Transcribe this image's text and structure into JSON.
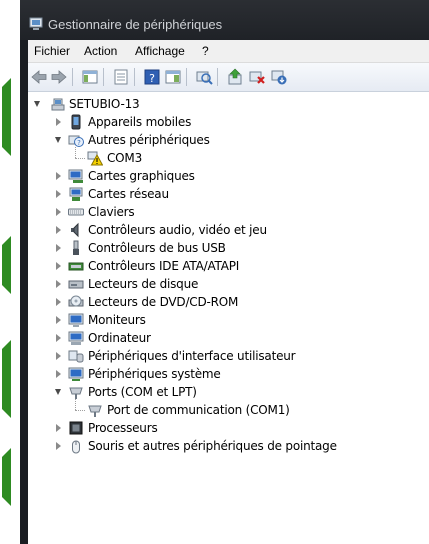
{
  "window": {
    "title": "Gestionnaire de périphériques"
  },
  "menu": {
    "file": "Fichier",
    "action": "Action",
    "view": "Affichage",
    "help": "?"
  },
  "tree": {
    "root": "SETUBIO-13",
    "items": [
      {
        "label": "Appareils mobiles",
        "icon": "mobile-device-icon",
        "expanded": false
      },
      {
        "label": "Autres périphériques",
        "icon": "unknown-device-icon",
        "expanded": true,
        "children": [
          {
            "label": "COM3",
            "icon": "warning-device-icon"
          }
        ]
      },
      {
        "label": "Cartes graphiques",
        "icon": "display-adapter-icon",
        "expanded": false
      },
      {
        "label": "Cartes réseau",
        "icon": "network-adapter-icon",
        "expanded": false
      },
      {
        "label": "Claviers",
        "icon": "keyboard-icon",
        "expanded": false
      },
      {
        "label": "Contrôleurs audio, vidéo et jeu",
        "icon": "speaker-icon",
        "expanded": false
      },
      {
        "label": "Contrôleurs de bus USB",
        "icon": "usb-icon",
        "expanded": false
      },
      {
        "label": "Contrôleurs IDE ATA/ATAPI",
        "icon": "ide-controller-icon",
        "expanded": false
      },
      {
        "label": "Lecteurs de disque",
        "icon": "disk-drive-icon",
        "expanded": false
      },
      {
        "label": "Lecteurs de DVD/CD-ROM",
        "icon": "dvd-drive-icon",
        "expanded": false
      },
      {
        "label": "Moniteurs",
        "icon": "monitor-icon",
        "expanded": false
      },
      {
        "label": "Ordinateur",
        "icon": "computer-icon",
        "expanded": false
      },
      {
        "label": "Périphériques d'interface utilisateur",
        "icon": "hid-icon",
        "expanded": false
      },
      {
        "label": "Périphériques système",
        "icon": "system-device-icon",
        "expanded": false
      },
      {
        "label": "Ports (COM et LPT)",
        "icon": "port-icon",
        "expanded": true,
        "children": [
          {
            "label": "Port de communication (COM1)",
            "icon": "port-icon"
          }
        ]
      },
      {
        "label": "Processeurs",
        "icon": "processor-icon",
        "expanded": false
      },
      {
        "label": "Souris et autres périphériques de pointage",
        "icon": "mouse-icon",
        "expanded": false
      }
    ]
  }
}
